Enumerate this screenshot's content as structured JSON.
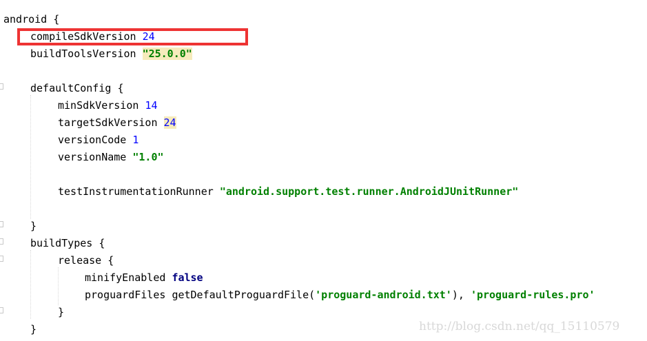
{
  "code_lines": [
    {
      "text": "android {"
    },
    {
      "key": "compileSdkVersion",
      "value": "24"
    },
    {
      "key": "buildToolsVersion",
      "value": "\"25.0.0\""
    },
    {
      "key": "defaultConfig",
      "brace": "{"
    },
    {
      "key": "minSdkVersion",
      "value": "14"
    },
    {
      "key": "targetSdkVersion",
      "value": "24"
    },
    {
      "key": "versionCode",
      "value": "1"
    },
    {
      "key": "versionName",
      "value": "\"1.0\""
    },
    {
      "key": "testInstrumentationRunner",
      "value": "\"android.support.test.runner.AndroidJUnitRunner\""
    },
    {
      "text": "}"
    },
    {
      "key": "buildTypes",
      "brace": "{"
    },
    {
      "key": "release",
      "brace": "{"
    },
    {
      "key": "minifyEnabled",
      "value": "false"
    },
    {
      "key": "proguardFiles",
      "call": "getDefaultProguardFile(",
      "arg1": "'proguard-android.txt'",
      "sep": "), ",
      "arg2": "'proguard-rules.pro'"
    },
    {
      "text": "}"
    },
    {
      "text": "}"
    }
  ],
  "watermark": "http://blog.csdn.net/qq_15110579",
  "colors": {
    "keyword": "#000080",
    "number": "#0000ff",
    "string": "#008000",
    "highlight_background": "#f6ebbc",
    "annotation_box": "#ee3333"
  }
}
